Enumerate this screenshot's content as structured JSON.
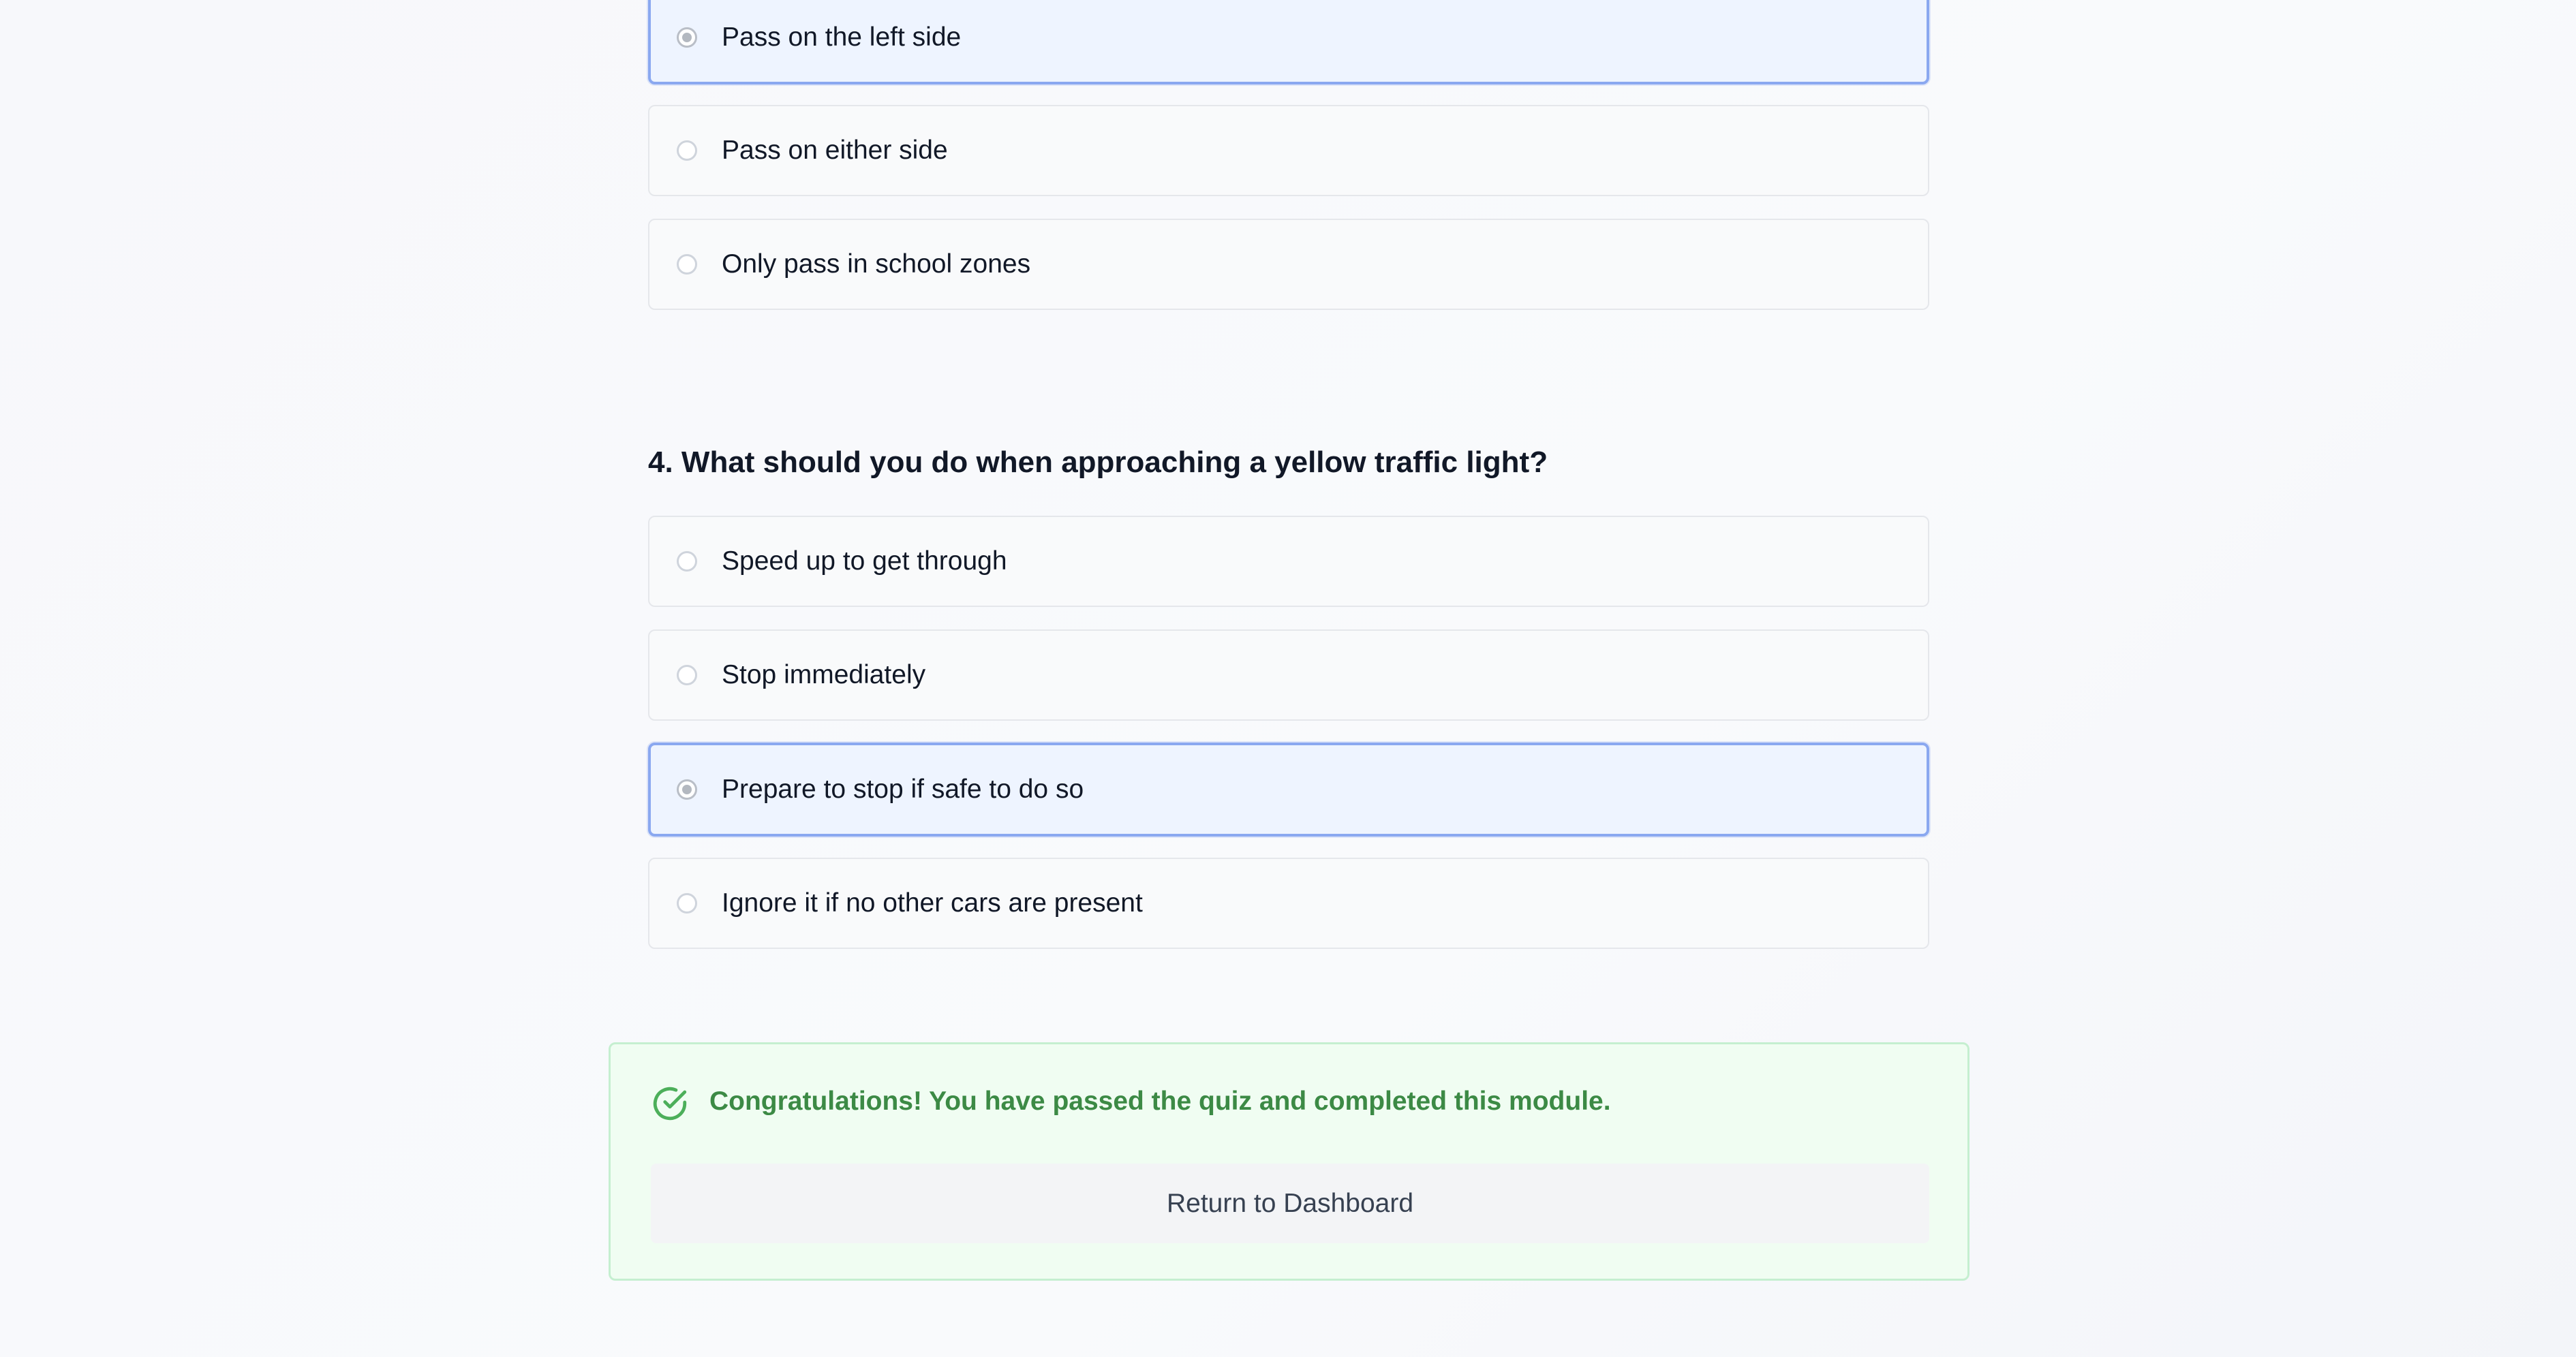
{
  "previous_question": {
    "options": [
      {
        "label": "Pass on the left side",
        "selected": true
      },
      {
        "label": "Pass on either side",
        "selected": false
      },
      {
        "label": "Only pass in school zones",
        "selected": false
      }
    ]
  },
  "question_4": {
    "title": "4. What should you do when approaching a yellow traffic light?",
    "options": [
      {
        "label": "Speed up to get through",
        "selected": false
      },
      {
        "label": "Stop immediately",
        "selected": false
      },
      {
        "label": "Prepare to stop if safe to do so",
        "selected": true
      },
      {
        "label": "Ignore it if no other cars are present",
        "selected": false
      }
    ]
  },
  "completion": {
    "message": "Congratulations! You have passed the quiz and completed this module.",
    "icon": "check-circle-icon",
    "button_label": "Return to Dashboard",
    "accent_color": "#3c8a45"
  },
  "colors": {
    "selected_border": "#8aa8f0",
    "selected_background": "#eef4ff",
    "success_background": "#f0fdf2"
  }
}
